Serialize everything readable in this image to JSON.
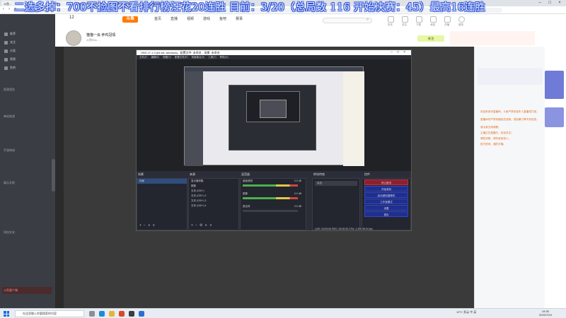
{
  "banner": {
    "text": "二选多掉：700不捡图不看排行榜汪花20连胜   目前：3/20（总局数 116   开始决赛：45）最高16连胜"
  },
  "browser": {
    "tabs": [
      {
        "label": "斗鱼..."
      },
      {
        "label": "斗鱼..."
      },
      {
        "label": "斗鱼..."
      },
      {
        "label": "你的斗鱼 - 斗鱼直播"
      },
      {
        "label": "斗鱼直播 - 斗鱼直播"
      },
      {
        "label": "斗鱼 | 斗鱼 直播..."
      },
      {
        "label": "斗鱼直播 - 斗鱼..."
      }
    ],
    "url": "https://www.douyu.com/..."
  },
  "sidebar": {
    "top_items": [
      {
        "label": "推荐"
      },
      {
        "label": "关注"
      },
      {
        "label": "分类"
      },
      {
        "label": "视频"
      },
      {
        "label": "鱼吧"
      }
    ],
    "sections": [
      {
        "title": "网游竞技"
      },
      {
        "title": "单机热游"
      },
      {
        "title": "手游休闲"
      },
      {
        "title": "娱乐天地"
      },
      {
        "title": "科技文化"
      }
    ],
    "bottom_label": "斗鱼客户端"
  },
  "site_nav": {
    "logo": "斗鱼",
    "items": [
      {
        "label": "首页"
      },
      {
        "label": "直播"
      },
      {
        "label": "视频"
      },
      {
        "label": "游戏"
      },
      {
        "label": "鱼吧"
      },
      {
        "label": "赛事"
      }
    ],
    "follow_count": "12",
    "top_icons": [
      {
        "label": "历史"
      },
      {
        "label": "关注"
      },
      {
        "label": "下载"
      },
      {
        "label": "消息"
      },
      {
        "label": "开播"
      },
      {
        "label": "登录"
      }
    ]
  },
  "stream": {
    "title": "猫猫一会  养鸡冠情",
    "subtitle": "斗鱼Rec ...",
    "follow_button": "关注"
  },
  "obs": {
    "title": "OBS 27.1.3 (64-bit, windows) - 配置文件: 未命名 - 场景: 未命名",
    "menu": [
      "文件(F)",
      "编辑(E)",
      "视图(V)",
      "配置文件(P)",
      "场景集合(S)",
      "工具(T)",
      "帮助(H)"
    ],
    "docks": {
      "scenes_title": "场景",
      "sources_title": "来源",
      "mixer_title": "混音器",
      "transitions_title": "转场特效",
      "controls_title": "控件"
    },
    "scenes": [
      "场景"
    ],
    "sources": [
      "显示器采集",
      "图像",
      "文本 (GDI+)",
      "文本 (GDI+) 2",
      "文本 (GDI+) 3",
      "文本 (GDI+) 4"
    ],
    "mixer_tracks": [
      {
        "name": "桌面音频",
        "db": "0.0 dB",
        "active": true
      },
      {
        "name": "图像",
        "db": "0.0 dB",
        "active": true
      },
      {
        "name": "麦克风",
        "db": "0.0 dB",
        "active": false
      }
    ],
    "transition": "淡出",
    "controls": [
      {
        "label": "停止推流",
        "stop": true
      },
      {
        "label": "开始录制"
      },
      {
        "label": "启动虚拟摄像机"
      },
      {
        "label": "工作室模式"
      },
      {
        "label": "设置"
      },
      {
        "label": "退出"
      }
    ],
    "status": "LIVE: 00:00:00    REC: 00:00:00    CPU: 1.3%, 59.94 fps"
  },
  "chat": {
    "lines": [
      "欢迎来到本直播间，斗鱼严禁未成年人直播或打赏。",
      "直播间内严禁传播违法违规、低俗暴力等不良信息，",
      "请大家文明观看。",
      "主播正在直播中，欢迎关注！",
      "理性消费，请勿轻信他人。",
      "官方房间，谨防诈骗。"
    ]
  },
  "taskbar": {
    "search_placeholder": "在这里输入你要搜索的内容",
    "tray": "19°C  多云  中  英",
    "time": "19:30",
    "date": "2022/7/24"
  },
  "colors": {
    "banner_text": "#e9f0ff",
    "banner_outline": "#2a4fd9",
    "logo": "#ff7a00",
    "obs_stop": "#8e1f2e",
    "obs_button": "#1f2f8f"
  }
}
